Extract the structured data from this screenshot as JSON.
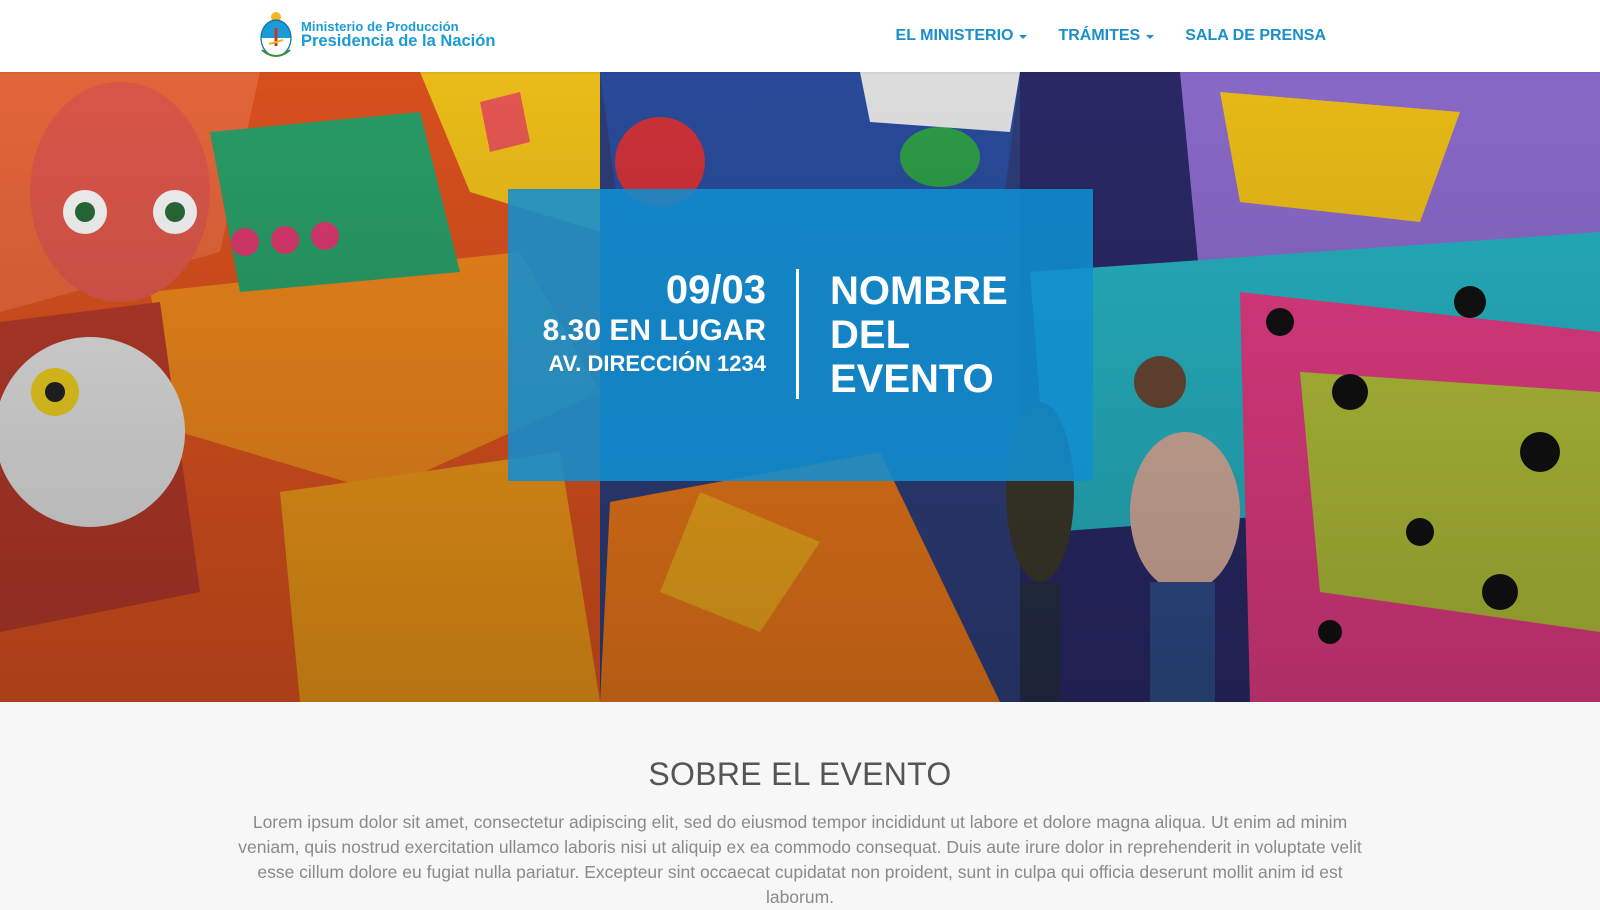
{
  "header": {
    "brand": {
      "line1": "Ministerio de Producción",
      "line2": "Presidencia de la Nación",
      "icon": "argentina-coat-of-arms-icon"
    },
    "nav": [
      {
        "label": "EL MINISTERIO",
        "has_dropdown": true
      },
      {
        "label": "TRÁMITES",
        "has_dropdown": true
      },
      {
        "label": "SALA DE PRENSA",
        "has_dropdown": false
      }
    ]
  },
  "hero": {
    "event": {
      "date": "09/03",
      "time_place": "8.30 EN LUGAR",
      "address": "AV. DIRECCIÓN 1234",
      "title": "NOMBRE DEL EVENTO"
    }
  },
  "about": {
    "heading": "SOBRE EL EVENTO",
    "body": "Lorem ipsum dolor sit amet, consectetur adipiscing elit, sed do eiusmod tempor incididunt ut labore et dolore magna aliqua. Ut enim ad minim veniam, quis nostrud exercitation ullamco laboris nisi ut aliquip ex ea commodo consequat. Duis aute irure dolor in reprehenderit in voluptate velit esse cillum dolore eu fugiat nulla pariatur. Excepteur sint occaecat cupidatat non proident, sunt in culpa qui officia deserunt mollit anim id est laborum."
  },
  "colors": {
    "brand_blue": "#1a9ad6",
    "nav_blue": "#1a8fc9",
    "card_blue": "#108ed0",
    "heading_gray": "#555555",
    "body_gray": "#8a8a8a",
    "section_bg": "#f7f7f7"
  }
}
